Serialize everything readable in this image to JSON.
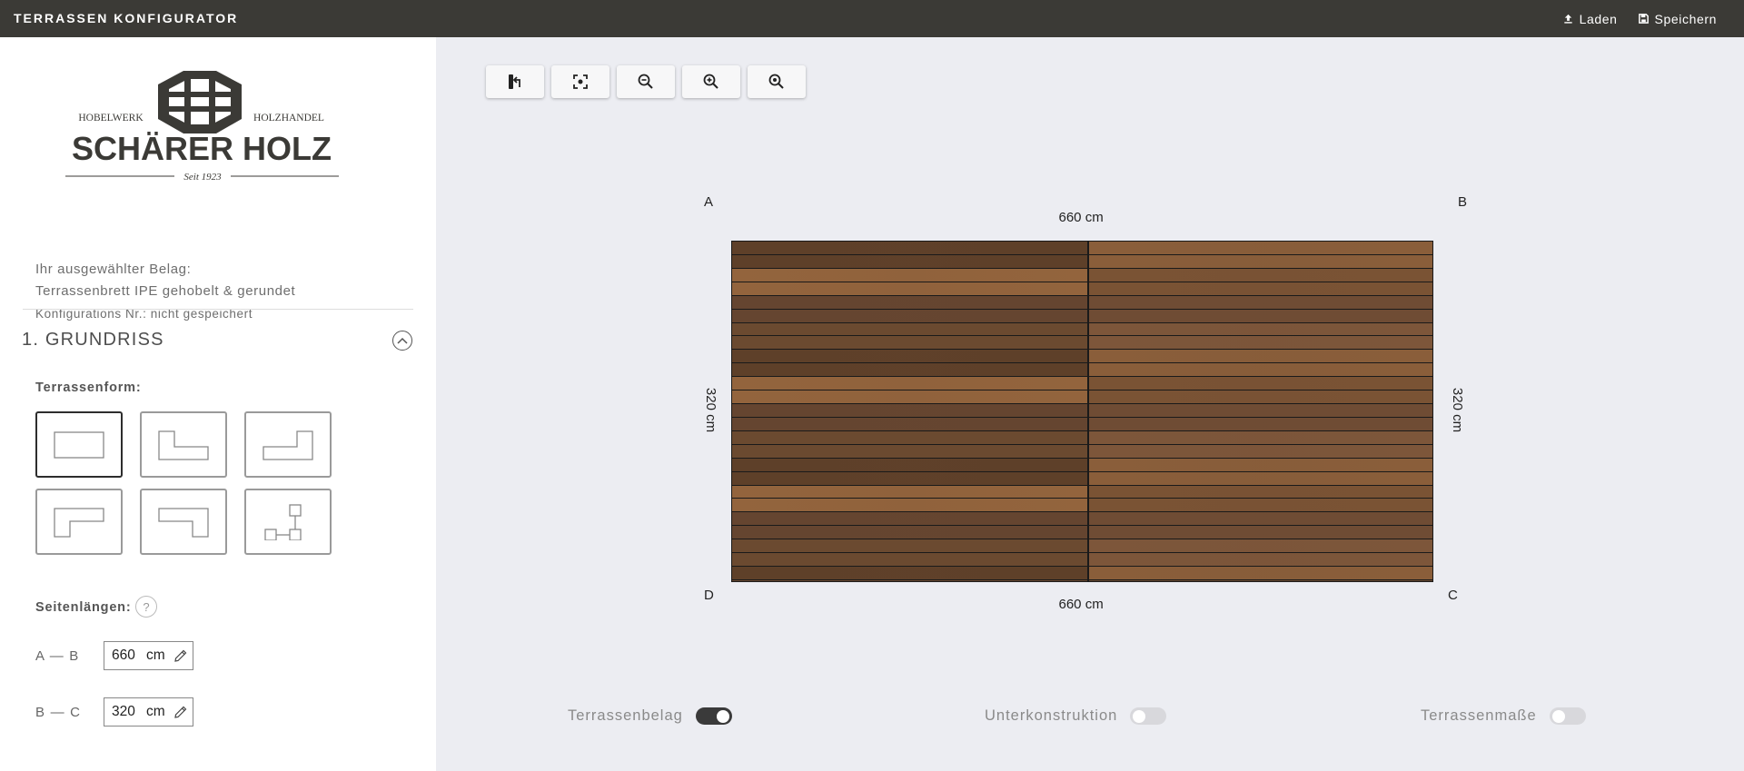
{
  "header": {
    "title": "TERRASSEN KONFIGURATOR",
    "load_label": "Laden",
    "save_label": "Speichern"
  },
  "brand": {
    "left_word": "HOBELWERK",
    "right_word": "HOLZHANDEL",
    "name": "SCHÄRER HOLZ",
    "since": "Seit 1923",
    "color": "#3b3a36"
  },
  "selection": {
    "heading": "Ihr ausgewählter Belag:",
    "product": "Terrassenbrett IPE gehobelt & gerundet",
    "config_number": "Konfigurations Nr.: nicht gespeichert"
  },
  "section": {
    "title": "1. GRUNDRISS",
    "shape_label": "Terrassenform:",
    "shapes": [
      {
        "name": "rectangle",
        "selected": true
      },
      {
        "name": "l-shape-top-left",
        "selected": false
      },
      {
        "name": "l-shape-top-right",
        "selected": false
      },
      {
        "name": "l-shape-bottom-left",
        "selected": false
      },
      {
        "name": "l-shape-bottom-right",
        "selected": false
      },
      {
        "name": "custom-shape",
        "selected": false
      }
    ],
    "side_lengths_label": "Seitenlängen:",
    "help_symbol": "?",
    "sides": [
      {
        "label": "A — B",
        "value": "660",
        "unit": "cm"
      },
      {
        "label": "B — C",
        "value": "320",
        "unit": "cm"
      }
    ]
  },
  "toolbar": {
    "icons": [
      "rotate-icon",
      "center-icon",
      "zoom-out-icon",
      "zoom-in-icon",
      "zoom-reset-icon"
    ]
  },
  "canvas": {
    "corners": {
      "a": "A",
      "b": "B",
      "c": "C",
      "d": "D"
    },
    "top_dimension": "660 cm",
    "bottom_dimension": "660 cm",
    "left_dimension": "320 cm",
    "right_dimension": "320 cm",
    "board_rows": 25,
    "wood_colors": [
      "#5e4029",
      "#7a5334",
      "#6b4a30",
      "#8a5e3a",
      "#654530",
      "#7d563a",
      "#93643d",
      "#6f4c34"
    ]
  },
  "toggles": [
    {
      "label": "Terrassenbelag",
      "on": true
    },
    {
      "label": "Unterkonstruktion",
      "on": false
    },
    {
      "label": "Terrassenmaße",
      "on": false
    }
  ]
}
